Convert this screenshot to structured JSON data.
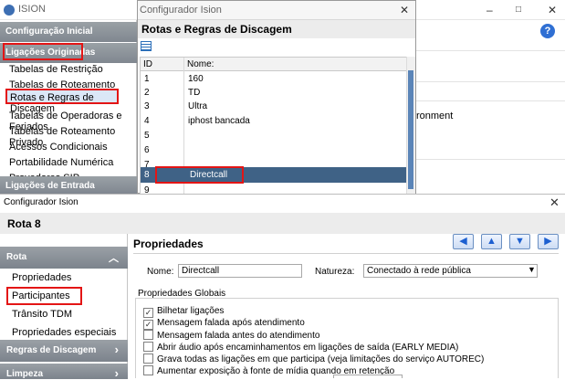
{
  "main_window": {
    "title": "ISION",
    "controls": [
      "–",
      "□",
      "✕"
    ],
    "sidebar": {
      "section_initial": "Configuração Inicial",
      "section_originated": "Ligações Originadas",
      "items": [
        "Tabelas de Restrição",
        "Tabelas de Roteamento",
        "Rotas e Regras de Discagem",
        "Tabelas de Operadoras e Feriados",
        "Tabelas de Roteamento Privado",
        "Acessos Condicionais",
        "Portabilidade Numérica",
        "Provedores SIP"
      ],
      "section_incoming": "Ligações de Entrada"
    },
    "right_text": "ronment",
    "help_label": "?"
  },
  "config_dialog": {
    "title": "Configurador Ision",
    "close": "✕",
    "header": "Rotas e Regras de Discagem",
    "table": {
      "columns": [
        "ID",
        "Nome:"
      ],
      "rows": [
        {
          "id": "1",
          "name": "160"
        },
        {
          "id": "2",
          "name": "TD"
        },
        {
          "id": "3",
          "name": "Ultra"
        },
        {
          "id": "4",
          "name": "iphost bancada"
        },
        {
          "id": "5",
          "name": ""
        },
        {
          "id": "6",
          "name": ""
        },
        {
          "id": "7",
          "name": ""
        },
        {
          "id": "8",
          "name": "Directcall"
        },
        {
          "id": "9",
          "name": ""
        }
      ],
      "selected_row": 8
    }
  },
  "route_window": {
    "title": "Configurador Ision",
    "close": "✕",
    "heading": "Rota 8",
    "nav": {
      "section_route": "Rota",
      "items": [
        "Propriedades",
        "Participantes",
        "Trânsito TDM",
        "Propriedades especiais"
      ],
      "section_rules": "Regras de Discagem",
      "section_cleanup": "Limpeza",
      "chevron_open": "︿",
      "chevron_closed": "›"
    },
    "properties": {
      "title": "Propriedades",
      "nav_buttons": [
        "◀",
        "▲",
        "▼",
        "▶"
      ],
      "name_label": "Nome:",
      "name_value": "Directcall",
      "nature_label": "Natureza:",
      "nature_value": "Conectado à rede pública",
      "nature_caret": "▼",
      "global_title": "Propriedades Globais",
      "options": [
        {
          "label": "Bilhetar ligações",
          "checked": true
        },
        {
          "label": "Mensagem falada após atendimento",
          "checked": true
        },
        {
          "label": "Mensagem falada antes do atendimento",
          "checked": false
        },
        {
          "label": "Abrir áudio após encaminhamentos em ligações de saída (EARLY MEDIA)",
          "checked": false
        },
        {
          "label": "Grava todas as ligações em que participa (veja limitações do serviço AUTOREC)",
          "checked": false
        },
        {
          "label": "Aumentar exposição à fonte de mídia quando em retenção",
          "checked": false
        }
      ]
    }
  },
  "colors": {
    "highlight_red": "#e31515",
    "selected_row": "#3f6286",
    "nav_header": "#808790",
    "nav_button_blue": "#1c5fd0"
  }
}
